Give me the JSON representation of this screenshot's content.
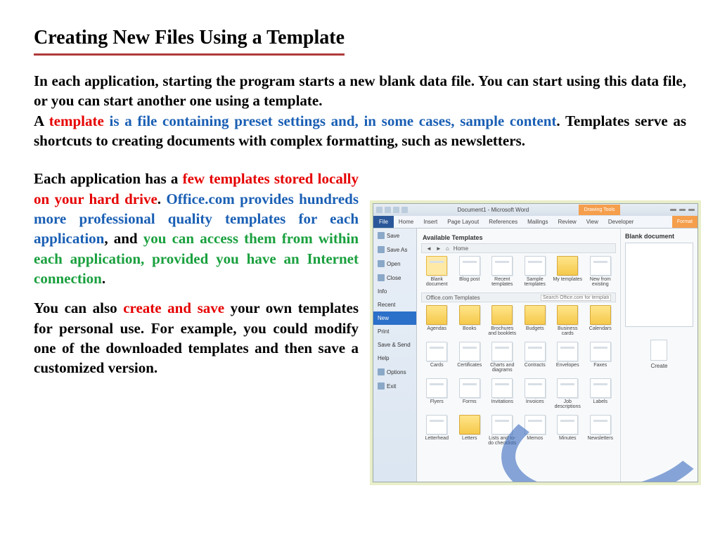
{
  "title": "Creating New Files Using a Template",
  "p1a": "In each application, starting the program starts a new blank data file. You can start using this data file, or you can start another one using a template.",
  "p1b_pre": "A ",
  "p1b_tpl": "template",
  "p1b_blue": " is a file containing preset settings and, in some cases, sample content",
  "p1b_post": ". Templates serve as shortcuts to creating documents with complex formatting, such as newsletters.",
  "p2a_pre": "Each application has a ",
  "p2a_red": "few templates stored locally on your hard drive",
  "p2a_dot": ". ",
  "p2a_blue": "Office.com provides hundreds more professional quality templates for each application",
  "p2a_mid": ", and ",
  "p2a_green": "you can access them from within each application, provided you have an Internet connection",
  "p2a_end": ".",
  "p3_pre": "You can also ",
  "p3_red": "create and save",
  "p3_post": " your own templates for personal use. For example, you could modify one of the downloaded templates and then save a customized version.",
  "shot": {
    "winTitle": "Document1 - Microsoft Word",
    "drawingTools": "Drawing Tools",
    "filetab": "File",
    "tabs": [
      "Home",
      "Insert",
      "Page Layout",
      "References",
      "Mailings",
      "Review",
      "View",
      "Developer"
    ],
    "formatTab": "Format",
    "sidebar": [
      "Save",
      "Save As",
      "Open",
      "Close",
      "Info",
      "Recent",
      "New",
      "Print",
      "Save & Send",
      "Help",
      "Options",
      "Exit"
    ],
    "activeSidebar": "New",
    "availHead": "Available Templates",
    "home": "Home",
    "row1": [
      "Blank document",
      "Blog post",
      "Recent templates",
      "Sample templates",
      "My templates",
      "New from existing"
    ],
    "officeHead": "Office.com Templates",
    "searchPH": "Search Office.com for templates",
    "row2": [
      "Agendas",
      "Books",
      "Brochures and booklets",
      "Budgets",
      "Business cards",
      "Calendars"
    ],
    "row3": [
      "Cards",
      "Certificates",
      "Charts and diagrams",
      "Contracts",
      "Envelopes",
      "Faxes"
    ],
    "row4": [
      "Flyers",
      "Forms",
      "Invitations",
      "Invoices",
      "Job descriptions",
      "Labels"
    ],
    "row5": [
      "Letterhead",
      "Letters",
      "Lists and to-do checklists",
      "Memos",
      "Minutes",
      "Newsletters"
    ],
    "previewTitle": "Blank document",
    "createLabel": "Create"
  }
}
